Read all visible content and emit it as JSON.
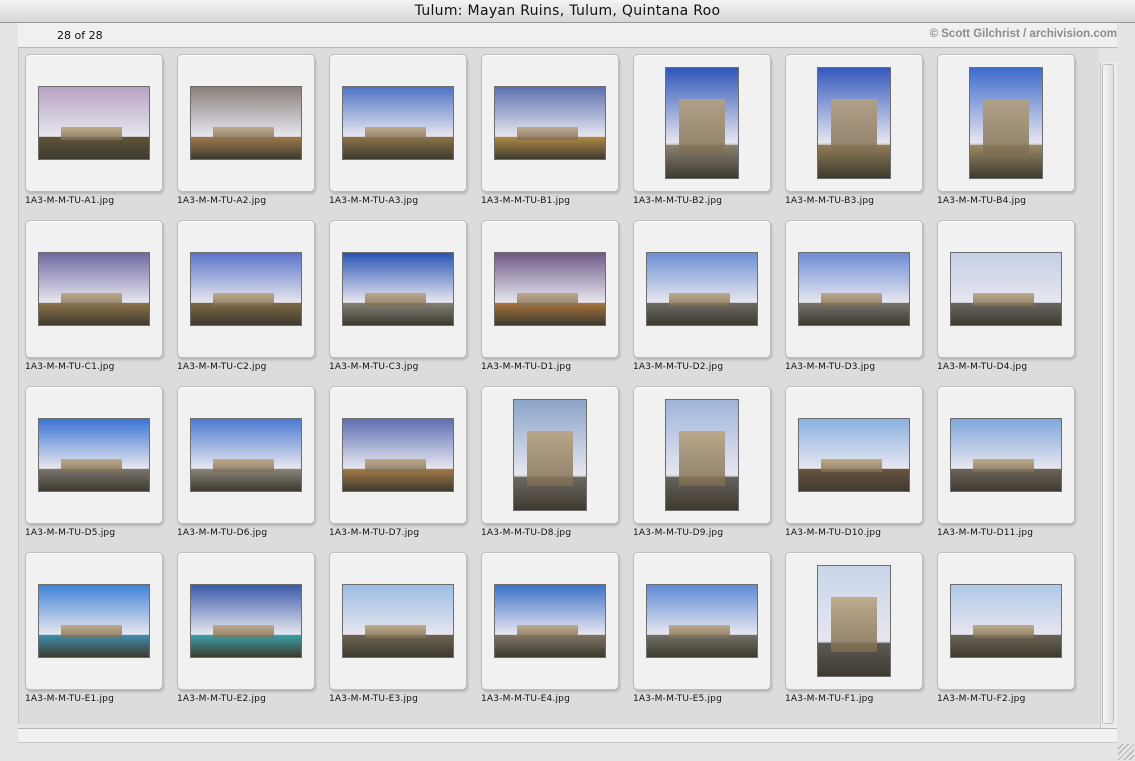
{
  "window": {
    "title": "Tulum: Mayan Ruins, Tulum, Quintana Roo"
  },
  "header": {
    "count": "28 of 28",
    "credit": "© Scott Gilchrist / archivision.com"
  },
  "thumbnails": [
    {
      "filename": "1A3-M-M-TU-A1.jpg",
      "orientation": "landscape",
      "sky": "#b7a3c2",
      "land": "#5e5438"
    },
    {
      "filename": "1A3-M-M-TU-A2.jpg",
      "orientation": "landscape",
      "sky": "#8a7f7a",
      "land": "#9c7a4a"
    },
    {
      "filename": "1A3-M-M-TU-A3.jpg",
      "orientation": "landscape",
      "sky": "#4e74c4",
      "land": "#8c7448"
    },
    {
      "filename": "1A3-M-M-TU-B1.jpg",
      "orientation": "landscape",
      "sky": "#5d6fae",
      "land": "#b08a44"
    },
    {
      "filename": "1A3-M-M-TU-B2.jpg",
      "orientation": "portrait",
      "sky": "#2f56b8",
      "land": "#8a8170"
    },
    {
      "filename": "1A3-M-M-TU-B3.jpg",
      "orientation": "portrait",
      "sky": "#3559bd",
      "land": "#8f7d56"
    },
    {
      "filename": "1A3-M-M-TU-B4.jpg",
      "orientation": "portrait",
      "sky": "#3d6acb",
      "land": "#9a8a64"
    },
    {
      "filename": "1A3-M-M-TU-C1.jpg",
      "orientation": "landscape",
      "sky": "#6f6aa0",
      "land": "#8c7448"
    },
    {
      "filename": "1A3-M-M-TU-C2.jpg",
      "orientation": "landscape",
      "sky": "#5a74c8",
      "land": "#7d6a44"
    },
    {
      "filename": "1A3-M-M-TU-C3.jpg",
      "orientation": "landscape",
      "sky": "#2a55b4",
      "land": "#858074"
    },
    {
      "filename": "1A3-M-M-TU-D1.jpg",
      "orientation": "landscape",
      "sky": "#6e5a86",
      "land": "#a8743c"
    },
    {
      "filename": "1A3-M-M-TU-D2.jpg",
      "orientation": "landscape",
      "sky": "#6c8fd2",
      "land": "#6e6a64"
    },
    {
      "filename": "1A3-M-M-TU-D3.jpg",
      "orientation": "landscape",
      "sky": "#6d8cd4",
      "land": "#77726a"
    },
    {
      "filename": "1A3-M-M-TU-D4.jpg",
      "orientation": "landscape",
      "sky": "#c4d0e6",
      "land": "#6a6560"
    },
    {
      "filename": "1A3-M-M-TU-D5.jpg",
      "orientation": "landscape",
      "sky": "#3b74d4",
      "land": "#7a766e"
    },
    {
      "filename": "1A3-M-M-TU-D6.jpg",
      "orientation": "landscape",
      "sky": "#4a7ad0",
      "land": "#88847a"
    },
    {
      "filename": "1A3-M-M-TU-D7.jpg",
      "orientation": "landscape",
      "sky": "#5e6fb2",
      "land": "#a47a46"
    },
    {
      "filename": "1A3-M-M-TU-D8.jpg",
      "orientation": "portrait",
      "sky": "#8aa4c8",
      "land": "#6d6860"
    },
    {
      "filename": "1A3-M-M-TU-D9.jpg",
      "orientation": "portrait",
      "sky": "#9fb4da",
      "land": "#66625c"
    },
    {
      "filename": "1A3-M-M-TU-D10.jpg",
      "orientation": "landscape",
      "sky": "#8ab0e0",
      "land": "#6a5440"
    },
    {
      "filename": "1A3-M-M-TU-D11.jpg",
      "orientation": "landscape",
      "sky": "#7fa6dc",
      "land": "#6c635a"
    },
    {
      "filename": "1A3-M-M-TU-E1.jpg",
      "orientation": "landscape",
      "sky": "#3f84d8",
      "land": "#3e8fae"
    },
    {
      "filename": "1A3-M-M-TU-E2.jpg",
      "orientation": "landscape",
      "sky": "#3a5aa8",
      "land": "#3aa0a8"
    },
    {
      "filename": "1A3-M-M-TU-E3.jpg",
      "orientation": "landscape",
      "sky": "#9cbce4",
      "land": "#6d6450"
    },
    {
      "filename": "1A3-M-M-TU-E4.jpg",
      "orientation": "landscape",
      "sky": "#3c72c8",
      "land": "#7e7466"
    },
    {
      "filename": "1A3-M-M-TU-E5.jpg",
      "orientation": "landscape",
      "sky": "#5e8ad4",
      "land": "#727066"
    },
    {
      "filename": "1A3-M-M-TU-F1.jpg",
      "orientation": "portrait",
      "sky": "#c8d6ea",
      "land": "#5d5a54"
    },
    {
      "filename": "1A3-M-M-TU-F2.jpg",
      "orientation": "landscape",
      "sky": "#b0c8e8",
      "land": "#6a6454"
    }
  ]
}
